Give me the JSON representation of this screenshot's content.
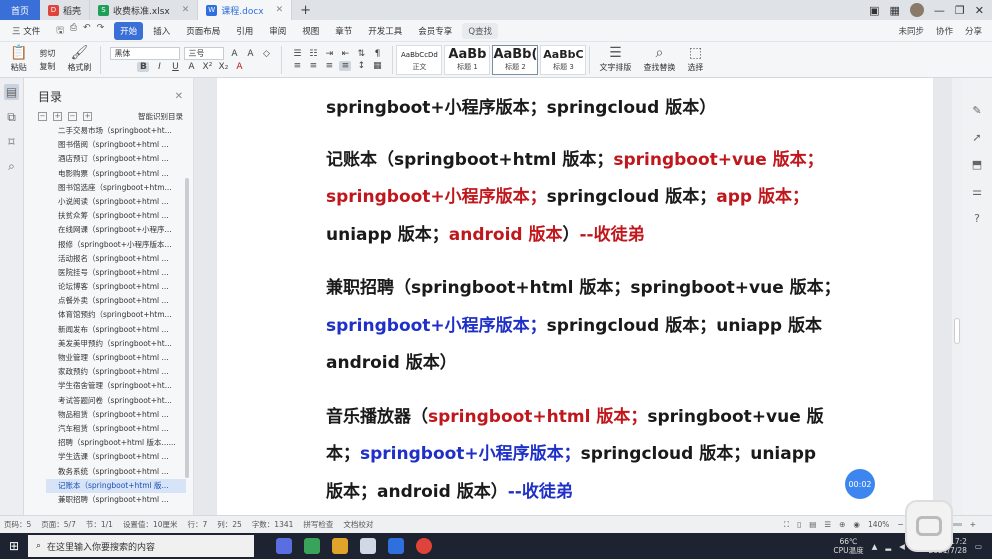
{
  "tabbar": {
    "home": "首页",
    "tabs": [
      {
        "label": "稻壳",
        "icon_color": "#e0433a",
        "icon_glyph": "D"
      },
      {
        "label": "收费标准.xlsx",
        "icon_color": "#1f9e57",
        "icon_glyph": "S"
      },
      {
        "label": "课程.docx",
        "icon_color": "#2f6fde",
        "icon_glyph": "W",
        "active": true
      }
    ],
    "add": "+",
    "win_icons": [
      "restore-icon",
      "minimize-icon",
      "maximize-icon",
      "close-icon"
    ]
  },
  "menubar": {
    "file": "三 文件",
    "items": [
      "开始",
      "插入",
      "页面布局",
      "引用",
      "审阅",
      "视图",
      "章节",
      "开发工具",
      "会员专享"
    ],
    "active_item": "开始",
    "search": "Q查找",
    "right": [
      "未同步",
      "协作",
      "分享"
    ]
  },
  "ribbon": {
    "clipboard": [
      "粘贴",
      "剪切",
      "复制",
      "格式刷"
    ],
    "font_name": "黑体",
    "font_size": "三号",
    "format_buttons": [
      "B",
      "I",
      "U",
      "A",
      "X²",
      "X₂",
      "A"
    ],
    "styles": [
      {
        "sample": "AaBbCcDd",
        "name": "正文"
      },
      {
        "sample": "AaBb",
        "name": "标题 1"
      },
      {
        "sample": "AaBb(",
        "name": "标题 2"
      },
      {
        "sample": "AaBbC",
        "name": "标题 3"
      }
    ],
    "tools": [
      "文字排版",
      "查找替换",
      "选择"
    ]
  },
  "toc": {
    "title": "目录",
    "smart": "智能识别目录",
    "items": [
      "二手交易市场（springboot+ht...",
      "图书借阅（springboot+html ...",
      "酒店预订（springboot+html ...",
      "电影购票（springboot+html ...",
      "图书馆选座（springboot+htm...",
      "小说阅读（springboot+html ...",
      "扶贫众筹（springboot+html ...",
      "在线网课（springboot+小程序...",
      "报修（springboot+小程序版本...",
      "活动报名（springboot+html ...",
      "医院挂号（springboot+html ...",
      "论坛博客（springboot+html ...",
      "点餐外卖（springboot+html ...",
      "体育馆预约（springboot+htm...",
      "新闻发布（springboot+html ...",
      "美发美甲预约（springboot+ht...",
      "物业管理（springboot+html ...",
      "家政预约（springboot+html ...",
      "学生宿舍管理（springboot+ht...",
      "考试答题问卷（springboot+ht...",
      "物品租赁（springboot+html ...",
      "汽车租赁（springboot+html ...",
      "招聘（springboot+html 版本......",
      "学生选课（springboot+html ...",
      "教务系统（springboot+html ...",
      "记账本（springboot+html 版...",
      "兼职招聘（springboot+html ..."
    ],
    "selected_index": 25
  },
  "document": {
    "p0": "springboot+小程序版本；springcloud 版本）",
    "p1": {
      "a": "记账本（springboot+html 版本；",
      "b": "springboot+vue 版本；",
      "c": "springboot+小程序版本；",
      "d": "springcloud 版本；",
      "e": "app 版本；",
      "f": "uniapp 版本；",
      "g": "android 版本",
      "h": "）",
      "i": "--收徒弟"
    },
    "p2": {
      "a": "兼职招聘（springboot+html 版本；springboot+vue 版本；",
      "b": "springboot+小程序版本；",
      "c": "springcloud 版本；uniapp 版本",
      "d": "android 版本）"
    },
    "p3": {
      "a": "音乐播放器（",
      "b": "springboot+html 版本；",
      "c": "springboot+vue 版",
      "d": "本；",
      "e": "springboot+小程序版本；",
      "f": "springcloud 版本；uniapp",
      "g": "版本；android 版本）",
      "h": "--收徒弟"
    }
  },
  "timer": "00:02",
  "statusbar": {
    "items": [
      "页码：5",
      "页面：5/7",
      "节：1/1",
      "设置值：10厘米",
      "行：7",
      "列：25",
      "字数：1341",
      "拼写检查",
      "文档校对"
    ],
    "zoom": "140%"
  },
  "taskbar": {
    "search_placeholder": "在这里输入你要搜索的内容",
    "temperature": "66℃",
    "cpu": "CPU温度",
    "time": "17:2",
    "date": "2021/7/28",
    "ime": "中",
    "app_colors": [
      "#5b6ee1",
      "#3aa35b",
      "#e0a42b",
      "#cfd8e3",
      "#2f6fde",
      "#e0433a"
    ]
  }
}
